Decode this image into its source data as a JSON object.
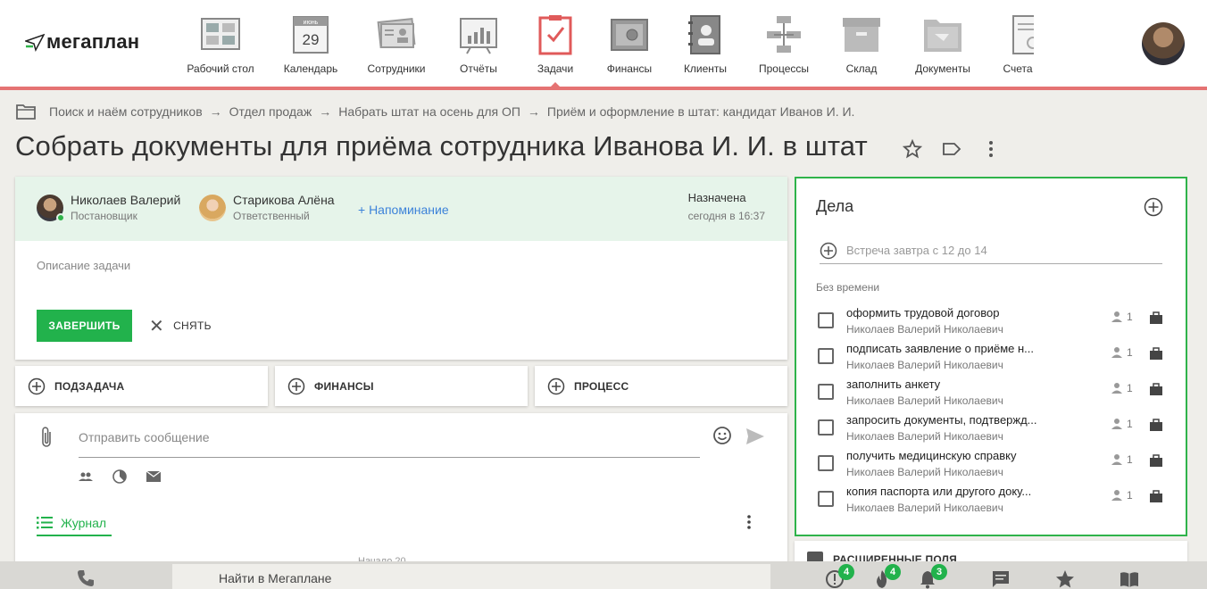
{
  "app": {
    "logo_text": "мегаплан",
    "nav": [
      {
        "label": "Рабочий стол",
        "icon": "desktop-icon"
      },
      {
        "label": "Календарь",
        "icon": "calendar-icon",
        "calendar_month": "июнь",
        "calendar_day": "29"
      },
      {
        "label": "Сотрудники",
        "icon": "employees-icon"
      },
      {
        "label": "Отчёты",
        "icon": "reports-icon"
      },
      {
        "label": "Задачи",
        "icon": "tasks-icon",
        "active": true
      },
      {
        "label": "Финансы",
        "icon": "finance-safe-icon"
      },
      {
        "label": "Клиенты",
        "icon": "clients-icon"
      },
      {
        "label": "Процессы",
        "icon": "processes-icon"
      },
      {
        "label": "Склад",
        "icon": "warehouse-icon"
      },
      {
        "label": "Документы",
        "icon": "documents-icon"
      },
      {
        "label": "Счета",
        "icon": "invoices-icon"
      }
    ],
    "colors": {
      "accent_red": "#e57373",
      "green": "#22b24c",
      "link_blue": "#3c82d9"
    }
  },
  "breadcrumb": [
    "Поиск и наём сотрудников",
    "Отдел продаж",
    "Набрать штат на осень для ОП",
    "Приём и оформление в штат: кандидат Иванов И. И."
  ],
  "breadcrumb_separator": "→",
  "task": {
    "title": "Собрать документы для приёма сотрудника Иванова И. И. в штат",
    "owner": {
      "name": "Николаев Валерий",
      "role": "Постановщик"
    },
    "responsible": {
      "name": "Старикова Алёна",
      "role": "Ответственный"
    },
    "reminder_label": "+ Напоминание",
    "status_label": "Назначена",
    "status_time": "сегодня в 16:37",
    "description_placeholder": "Описание задачи",
    "complete_label": "ЗАВЕРШИТЬ",
    "cancel_label": "СНЯТЬ"
  },
  "actions": {
    "subtask": "ПОДЗАДАЧА",
    "finance": "ФИНАНСЫ",
    "process": "ПРОЦЕСС"
  },
  "message": {
    "placeholder": "Отправить сообщение",
    "journal_tab": "Журнал",
    "journal_peek": "Начало 20"
  },
  "deals": {
    "title": "Дела",
    "new_placeholder": "Встреча завтра с 12 до 14",
    "section": "Без времени",
    "items": [
      {
        "title": "оформить трудовой договор",
        "person": "Николаев Валерий Николаевич",
        "count": "1"
      },
      {
        "title": "подписать заявление о приёме н...",
        "person": "Николаев Валерий Николаевич",
        "count": "1"
      },
      {
        "title": "заполнить анкету",
        "person": "Николаев Валерий Николаевич",
        "count": "1"
      },
      {
        "title": "запросить документы, подтвержд...",
        "person": "Николаев Валерий Николаевич",
        "count": "1"
      },
      {
        "title": "получить медицинскую справку",
        "person": "Николаев Валерий Николаевич",
        "count": "1"
      },
      {
        "title": "копия паспорта или другого доку...",
        "person": "Николаев Валерий Николаевич",
        "count": "1"
      }
    ]
  },
  "extended_fields": "РАСШИРЕННЫЕ ПОЛЯ",
  "bottom": {
    "search": "Найти в Мегаплане",
    "badges": {
      "alerts": "4",
      "hot": "4",
      "notifications": "3"
    }
  }
}
